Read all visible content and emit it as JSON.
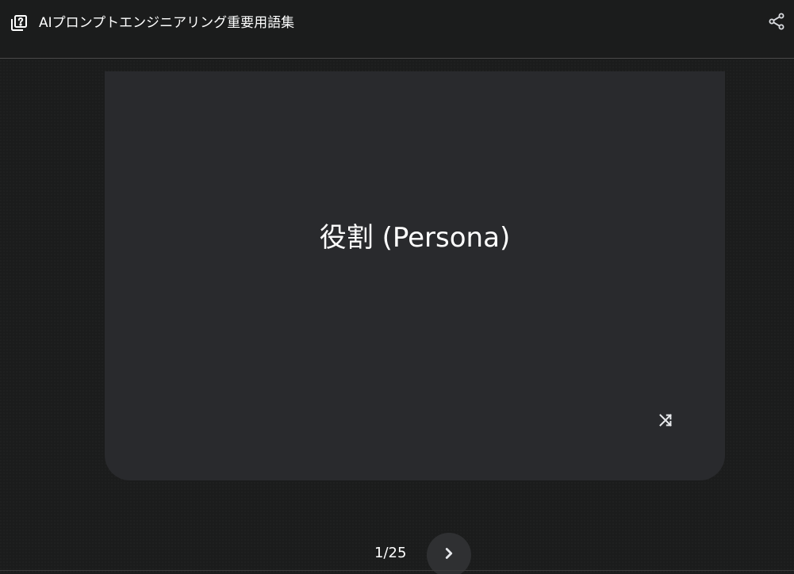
{
  "header": {
    "title": "AIプロンプトエンジニアリング重要用語集",
    "deck_icon": "flashcard-deck-icon",
    "share_icon": "share-icon"
  },
  "card": {
    "term": "役割 (Persona)",
    "shuffle_icon": "shuffle-icon"
  },
  "navigation": {
    "counter": "1/25",
    "next_icon": "chevron-right-icon"
  },
  "colors": {
    "background": "#1b1c1c",
    "card": "#292a2d",
    "text": "#ffffff"
  }
}
